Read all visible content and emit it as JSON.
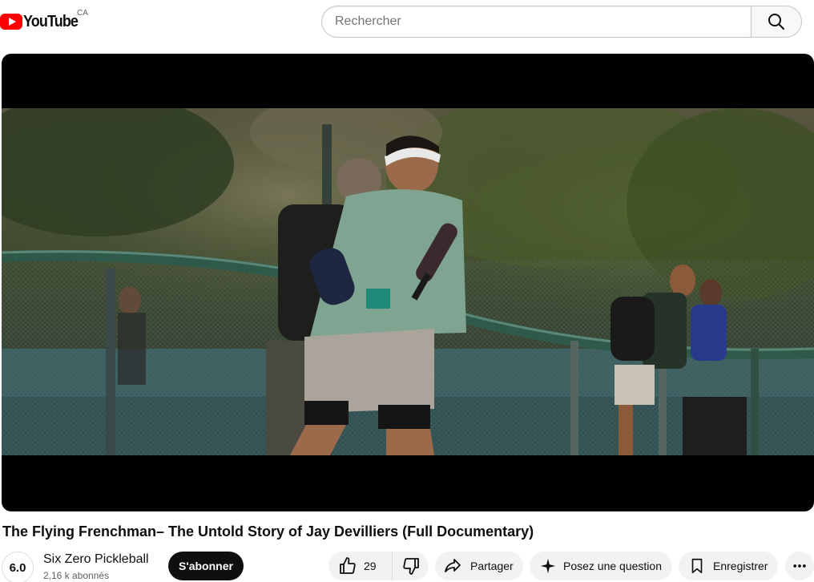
{
  "header": {
    "logo_text": "YouTube",
    "region": "CA",
    "search_placeholder": "Rechercher"
  },
  "video": {
    "title": "The Flying Frenchman– The Untold Story of Jay Devilliers (Full Documentary)"
  },
  "channel": {
    "avatar_text": "6.0",
    "name": "Six Zero Pickleball",
    "subscribers": "2,16 k abonnés",
    "subscribe_label": "S'abonner"
  },
  "actions": {
    "like_count": "29",
    "share_label": "Partager",
    "ask_label": "Posez une question",
    "save_label": "Enregistrer"
  },
  "colors": {
    "brand": "#ff0000",
    "subscribe_bg": "#0f0f0f",
    "pill_bg": "#f2f2f2"
  },
  "icons": [
    "youtube-logo-icon",
    "search-icon",
    "thumbs-up-icon",
    "thumbs-down-icon",
    "share-icon",
    "sparkle-icon",
    "bookmark-icon",
    "more-icon"
  ]
}
